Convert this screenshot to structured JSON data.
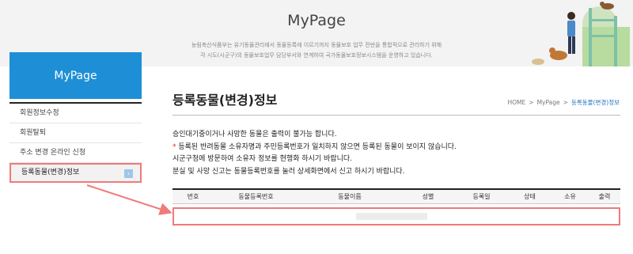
{
  "banner": {
    "title": "MyPage",
    "desc_line1": "농림축산식품부는 유기동물관리에서 동물등록에 이르기까지 동물보호 업무 전반을 통합적으로 관리하기 위해",
    "desc_line2": "각 시도(시군구)의 동물보호업무 담당부서와 연계하여 국가동물보호정보시스템을 운영하고 있습니다."
  },
  "sidebar": {
    "title": "MyPage",
    "items": [
      {
        "label": "회원정보수정"
      },
      {
        "label": "회원탈퇴"
      },
      {
        "label": "주소 변경 온라인 신청"
      },
      {
        "label": "등록동물(변경)정보"
      }
    ],
    "active_chevron": "›"
  },
  "main": {
    "title": "등록동물(변경)정보",
    "breadcrumb": [
      "HOME",
      "MyPage",
      "등록동물(변경)정보"
    ],
    "breadcrumb_sep": ">",
    "notice": {
      "line1": "승인대기중이거나 사망한 동물은 출력이 불가능 합니다.",
      "line2_star": "*",
      "line2": " 등록된 반려동물 소유자명과 주민등록번호가 일치하지 않으면 등록된 동물이 보이지 않습니다.",
      "line3": "시군구청에 방문하여 소유자 정보를 현행화 하시기 바랍니다.",
      "line4": "분실 및 사망 신고는 동물등록번호를 눌러 상세화면에서 신고 하시기 바랍니다."
    },
    "table": {
      "headers": [
        "번호",
        "동물등록번호",
        "동물이름",
        "성별",
        "등록일",
        "상태",
        "소유",
        "출력"
      ]
    }
  },
  "colors": {
    "accent": "#1e8fd6",
    "highlight": "#f07a7a",
    "required_star": "#e02020"
  }
}
